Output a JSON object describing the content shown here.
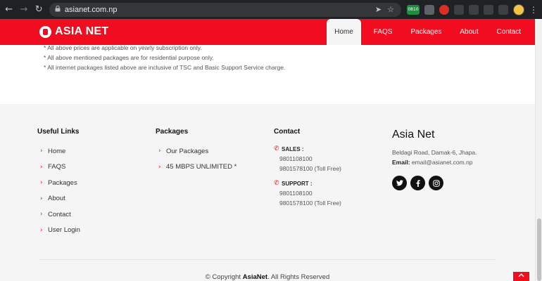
{
  "browser": {
    "url": "asianet.com.np",
    "back_icon": "←",
    "forward_icon": "→",
    "reload_icon": "↻",
    "lock_icon": "🔒",
    "share_icon": "➤",
    "star_icon": "☆",
    "ext_badge": "0810",
    "menu_icon": "⋮"
  },
  "header": {
    "logo_text": "ASIA NET",
    "nav": [
      {
        "label": "Home",
        "active": true
      },
      {
        "label": "FAQS"
      },
      {
        "label": "Packages"
      },
      {
        "label": "About"
      },
      {
        "label": "Contact"
      }
    ]
  },
  "notes": [
    "* All above prices are applicable on yearly subscription only.",
    "* All above mentioned packages are for residential purpose only.",
    "* All internet packages listed above are inclusive of TSC and Basic Support Service charge."
  ],
  "footer": {
    "useful_links": {
      "title": "Useful Links",
      "items": [
        "Home",
        "FAQS",
        "Packages",
        "About",
        "Contact",
        "User Login"
      ]
    },
    "packages": {
      "title": "Packages",
      "items": [
        "Our Packages",
        "45 MBPS UNLIMITED *"
      ]
    },
    "contact": {
      "title": "Contact",
      "sales_label": "SALES :",
      "sales_lines": [
        "9801108100",
        "9801578100 (Toll Free)"
      ],
      "support_label": "SUPPORT :",
      "support_lines": [
        "9801108100",
        "9801578100 (Toll Free)"
      ]
    },
    "brand": {
      "title": "Asia Net",
      "address": "Beldagi Road, Damak-6, Jhapa.",
      "email_label": "Email:",
      "email": "email@asianet.com.np"
    },
    "copyright_prefix": "© Copyright ",
    "copyright_brand": "AsiaNet",
    "copyright_suffix": ". All Rights Reserved"
  },
  "colors": {
    "brand_red": "#f20c1f",
    "footer_bg": "#f5f5f5"
  }
}
